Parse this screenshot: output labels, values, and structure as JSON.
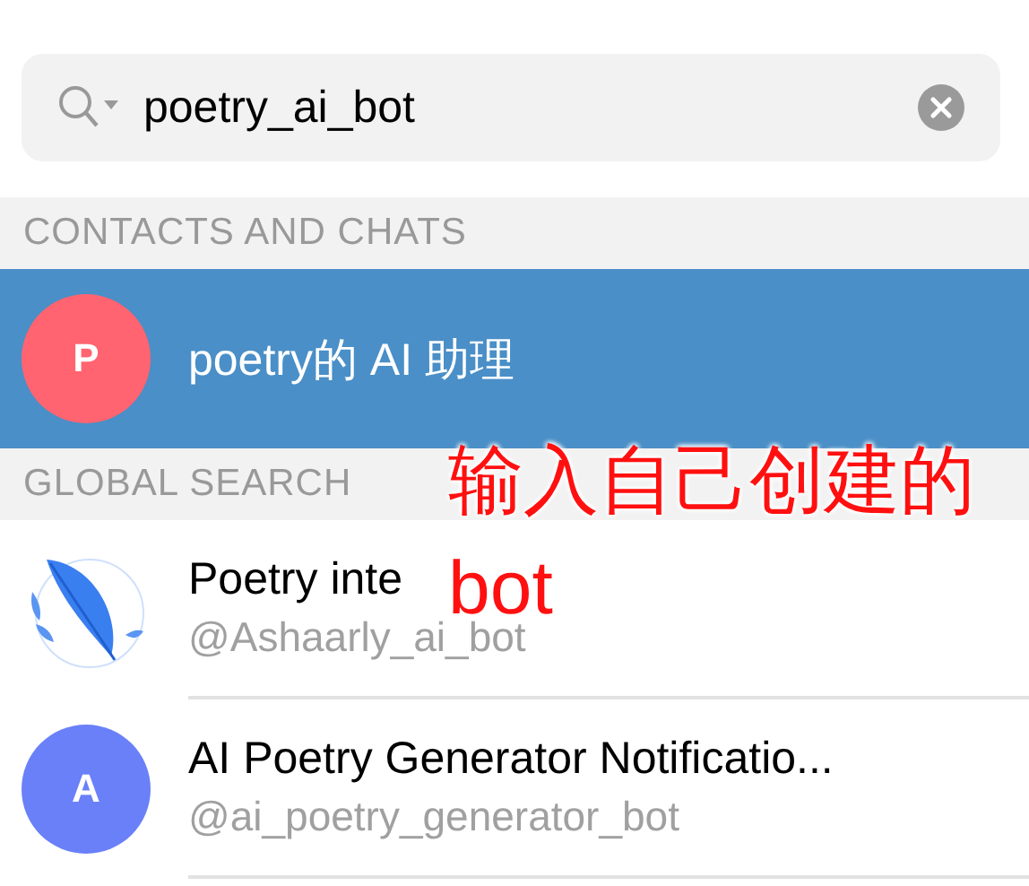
{
  "search": {
    "value": "poetry_ai_bot"
  },
  "sections": [
    {
      "title": "CONTACTS AND CHATS",
      "items": [
        {
          "kind": "letter",
          "letter": "P",
          "color": "#ff6470",
          "name": "poetry的 AI 助理",
          "selected": true
        }
      ]
    },
    {
      "title": "GLOBAL SEARCH",
      "items": [
        {
          "kind": "picture",
          "name": "Poetry inte",
          "username": "@Ashaarly_ai_bot",
          "selected": false
        },
        {
          "kind": "letter",
          "letter": "A",
          "color": "#6a80f8",
          "name": "AI Poetry Generator Notificatio...",
          "username": "@ai_poetry_generator_bot",
          "selected": false
        }
      ]
    }
  ],
  "annotation": {
    "lines": [
      "输入自己创建的",
      "bot"
    ]
  }
}
